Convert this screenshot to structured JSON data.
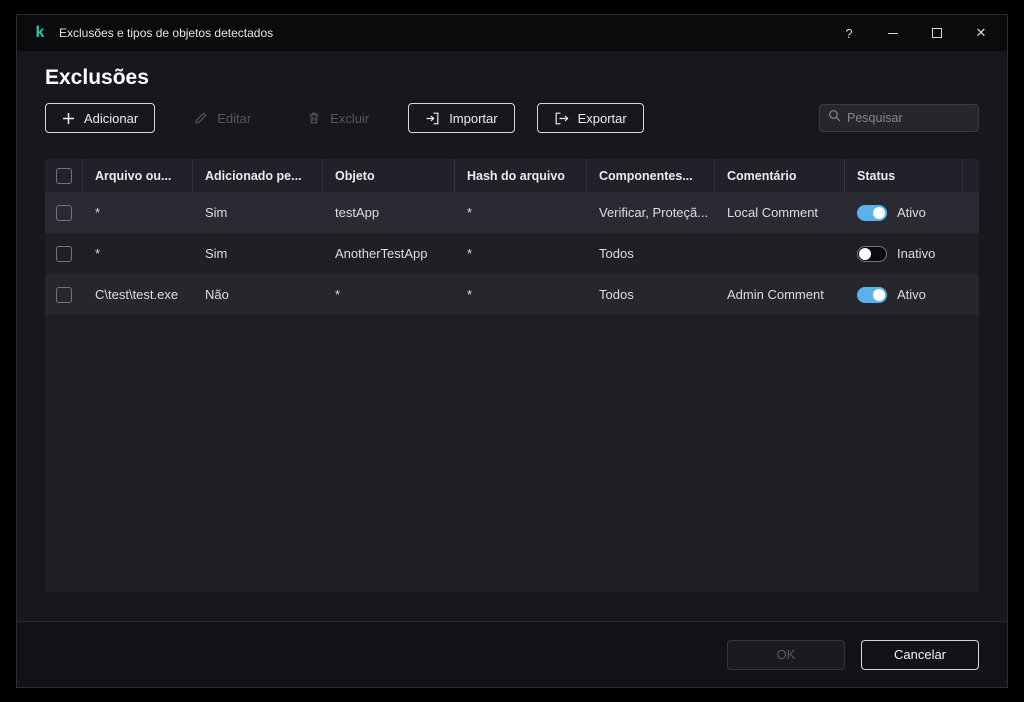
{
  "window": {
    "title": "Exclusões e tipos de objetos detectados",
    "titlebar": {
      "help": "?",
      "close": "✕"
    }
  },
  "page": {
    "heading": "Exclusões"
  },
  "toolbar": {
    "add_label": "Adicionar",
    "edit_label": "Editar",
    "delete_label": "Excluir",
    "import_label": "Importar",
    "export_label": "Exportar",
    "search_placeholder": "Pesquisar"
  },
  "table": {
    "columns": [
      "Arquivo ou...",
      "Adicionado pe...",
      "Objeto",
      "Hash do arquivo",
      "Componentes...",
      "Comentário",
      "Status"
    ],
    "rows": [
      {
        "file": "*",
        "added": "Sim",
        "object": "testApp",
        "hash": "*",
        "components": "Verificar, Proteçã...",
        "comment": "Local Comment",
        "status": "Ativo",
        "active": true
      },
      {
        "file": "*",
        "added": "Sim",
        "object": "AnotherTestApp",
        "hash": "*",
        "components": "Todos",
        "comment": "",
        "status": "Inativo",
        "active": false
      },
      {
        "file": "C\\test\\test.exe",
        "added": "Não",
        "object": "*",
        "hash": "*",
        "components": "Todos",
        "comment": "Admin Comment",
        "status": "Ativo",
        "active": true
      }
    ]
  },
  "footer": {
    "ok_label": "OK",
    "cancel_label": "Cancelar"
  },
  "colors": {
    "brand_green": "#23c9a4",
    "toggle_active": "#59b2ea"
  }
}
